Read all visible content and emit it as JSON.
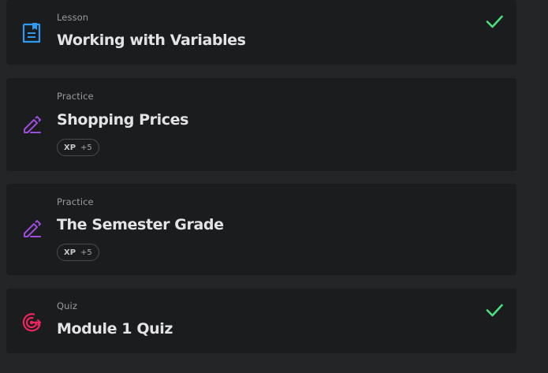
{
  "items": [
    {
      "type": "Lesson",
      "title": "Working with Variables",
      "icon": "document-icon",
      "completed": true
    },
    {
      "type": "Practice",
      "title": "Shopping Prices",
      "icon": "edit-pen-icon",
      "xp_label": "XP",
      "xp_value": "+5",
      "completed": false
    },
    {
      "type": "Practice",
      "title": "The Semester Grade",
      "icon": "edit-pen-icon",
      "xp_label": "XP",
      "xp_value": "+5",
      "completed": false
    },
    {
      "type": "Quiz",
      "title": "Module 1 Quiz",
      "icon": "target-icon",
      "completed": true
    }
  ],
  "colors": {
    "lesson_icon": "#2e9bf0",
    "practice_icon": "#9d4edd",
    "quiz_icon": "#f0245e",
    "check": "#4ade80",
    "card_bg": "#1b1c1e",
    "page_bg": "#242527"
  }
}
